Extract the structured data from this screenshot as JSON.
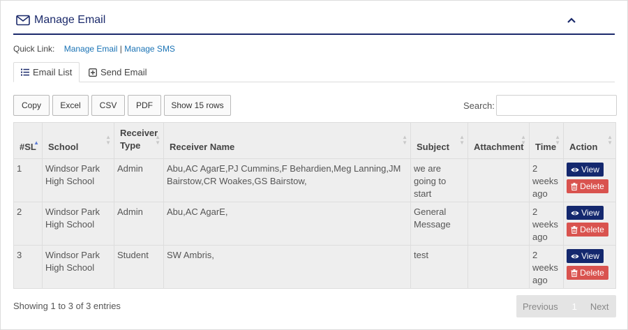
{
  "header": {
    "title": "Manage Email"
  },
  "quick_links": {
    "label": "Quick Link:",
    "link1": "Manage Email",
    "separator": "|",
    "link2": "Manage SMS"
  },
  "tabs": [
    {
      "label": "Email List"
    },
    {
      "label": "Send Email"
    }
  ],
  "toolbar": {
    "buttons": [
      "Copy",
      "Excel",
      "CSV",
      "PDF",
      "Show 15 rows"
    ]
  },
  "search": {
    "label": "Search:",
    "value": ""
  },
  "table": {
    "columns": [
      "#SL",
      "School",
      "Receiver Type",
      "Receiver Name",
      "Subject",
      "Attachment",
      "Time",
      "Action"
    ],
    "rows": [
      {
        "sl": "1",
        "school": "Windsor Park High School",
        "receiver_type": "Admin",
        "receiver_name": "Abu,AC AgarE,PJ Cummins,F Behardien,Meg Lanning,JM Bairstow,CR Woakes,GS Bairstow,",
        "subject": "we are going to start",
        "attachment": "",
        "time": "2 weeks ago"
      },
      {
        "sl": "2",
        "school": "Windsor Park High School",
        "receiver_type": "Admin",
        "receiver_name": "Abu,AC AgarE,",
        "subject": "General Message",
        "attachment": "",
        "time": "2 weeks ago"
      },
      {
        "sl": "3",
        "school": "Windsor Park High School",
        "receiver_type": "Student",
        "receiver_name": "SW Ambris,",
        "subject": "test",
        "attachment": "",
        "time": "2 weeks ago"
      }
    ],
    "actions": {
      "view": "View",
      "delete": "Delete"
    }
  },
  "footer": {
    "info": "Showing 1 to 3 of 3 entries",
    "previous": "Previous",
    "page": "1",
    "next": "Next"
  },
  "colors": {
    "brand": "#1b2a6b",
    "link": "#1a73b5",
    "danger": "#d9534f",
    "view": "#14286e"
  },
  "icons": {
    "header": "envelope-icon",
    "collapse": "chevron-up-icon",
    "email_list": "list-icon",
    "send_email": "plus-square-icon",
    "view": "eye-icon",
    "delete": "trash-icon"
  }
}
